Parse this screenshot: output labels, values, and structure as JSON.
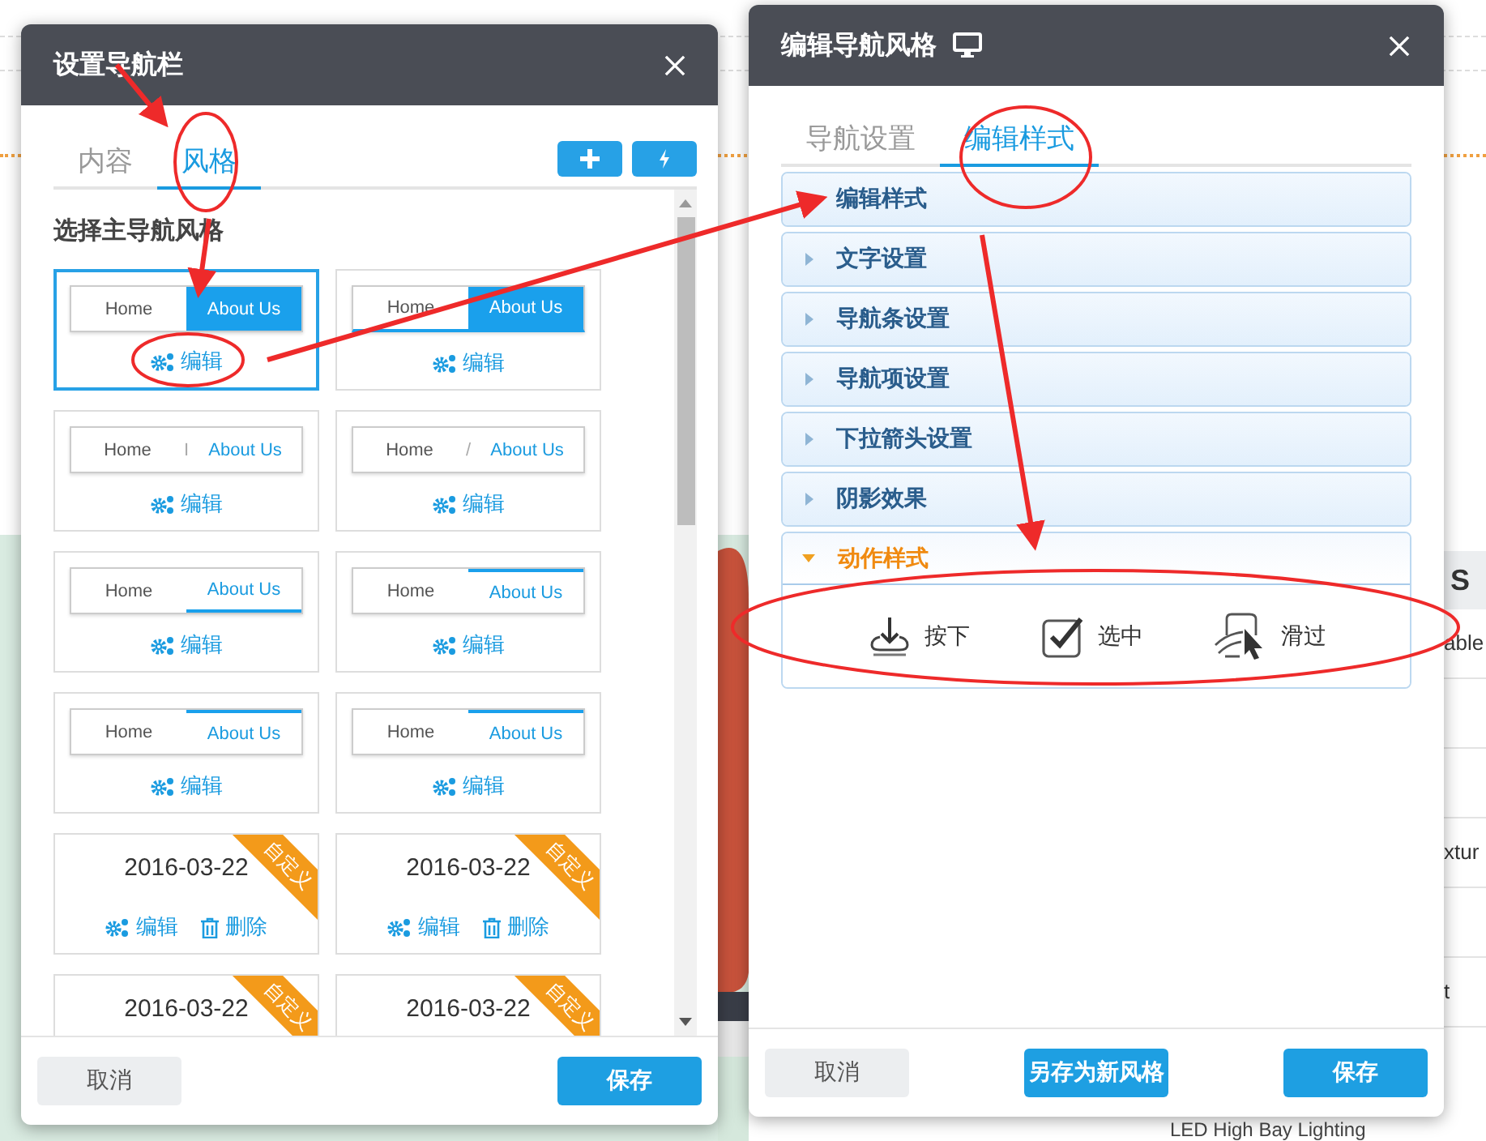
{
  "background": {
    "table": {
      "header": "S",
      "rows": [
        "able",
        "",
        "",
        "xtur",
        "",
        "t"
      ]
    },
    "link": "LED High Bay Lighting"
  },
  "nav_dialog": {
    "title": "设置导航栏",
    "tabs": [
      {
        "label": "内容",
        "selected": false
      },
      {
        "label": "风格",
        "selected": true
      }
    ],
    "section_title": "选择主导航风格",
    "styles": [
      {
        "kind": "preview",
        "home": "Home",
        "about": "About Us",
        "selected": true,
        "actions": [
          {
            "kind": "edit",
            "label": "编辑"
          }
        ]
      },
      {
        "kind": "preview",
        "home": "Home",
        "about": "About Us",
        "selected": false,
        "actions": [
          {
            "kind": "edit",
            "label": "编辑"
          }
        ]
      },
      {
        "kind": "preview",
        "home": "Home",
        "separator": "I",
        "about": "About Us",
        "selected": false,
        "actions": [
          {
            "kind": "edit",
            "label": "编辑"
          }
        ]
      },
      {
        "kind": "preview",
        "home": "Home",
        "separator": "/",
        "about": "About Us",
        "selected": false,
        "actions": [
          {
            "kind": "edit",
            "label": "编辑"
          }
        ]
      },
      {
        "kind": "preview",
        "home": "Home",
        "about": "About Us",
        "selected": false,
        "actions": [
          {
            "kind": "edit",
            "label": "编辑"
          }
        ]
      },
      {
        "kind": "preview",
        "home": "Home",
        "about": "About Us",
        "selected": false,
        "actions": [
          {
            "kind": "edit",
            "label": "编辑"
          }
        ]
      },
      {
        "kind": "preview",
        "home": "Home",
        "about": "About Us",
        "selected": false,
        "actions": [
          {
            "kind": "edit",
            "label": "编辑"
          }
        ]
      },
      {
        "kind": "preview",
        "home": "Home",
        "about": "About Us",
        "selected": false,
        "actions": [
          {
            "kind": "edit",
            "label": "编辑"
          }
        ]
      },
      {
        "kind": "custom",
        "date": "2016-03-22",
        "ribbon": "自定义",
        "selected": false,
        "actions": [
          {
            "kind": "edit",
            "label": "编辑"
          },
          {
            "kind": "delete",
            "label": "删除"
          }
        ]
      },
      {
        "kind": "custom",
        "date": "2016-03-22",
        "ribbon": "自定义",
        "selected": false,
        "actions": [
          {
            "kind": "edit",
            "label": "编辑"
          },
          {
            "kind": "delete",
            "label": "删除"
          }
        ]
      },
      {
        "kind": "custom",
        "date": "2016-03-22",
        "ribbon": "自定义",
        "selected": false
      },
      {
        "kind": "custom",
        "date": "2016-03-22",
        "ribbon": "自定义",
        "selected": false
      }
    ],
    "buttons": [
      {
        "kind": "cancel",
        "label": "取消"
      },
      {
        "kind": "save",
        "label": "保存"
      }
    ]
  },
  "style_dialog": {
    "title": "编辑导航风格",
    "tabs": [
      {
        "label": "导航设置",
        "selected": false
      },
      {
        "label": "编辑样式",
        "selected": true
      }
    ],
    "sections": [
      {
        "label": "编辑样式",
        "expanded": false
      },
      {
        "label": "文字设置",
        "expanded": false
      },
      {
        "label": "导航条设置",
        "expanded": false
      },
      {
        "label": "导航项设置",
        "expanded": false
      },
      {
        "label": "下拉箭头设置",
        "expanded": false
      },
      {
        "label": "阴影效果",
        "expanded": false
      },
      {
        "label": "动作样式",
        "expanded": true,
        "options": [
          {
            "kind": "press",
            "label": "按下"
          },
          {
            "kind": "select",
            "label": "选中"
          },
          {
            "kind": "hover",
            "label": "滑过"
          }
        ]
      }
    ],
    "buttons": [
      {
        "kind": "cancel",
        "label": "取消"
      },
      {
        "kind": "save-new",
        "label": "另存为新风格"
      },
      {
        "kind": "save",
        "label": "保存"
      }
    ]
  }
}
